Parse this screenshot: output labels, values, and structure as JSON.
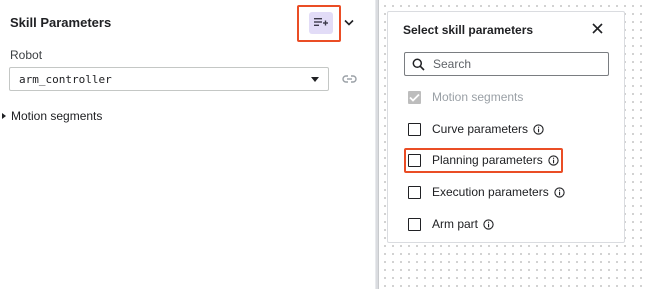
{
  "panel": {
    "title": "Skill Parameters",
    "robot_label": "Robot",
    "robot_value": "arm_controller",
    "motion_segments_label": "Motion segments"
  },
  "icons": {
    "add_parameter": "playlist-add-icon",
    "chevron": "chevron-down-icon",
    "link": "link-icon",
    "close": "close-icon",
    "search": "search-icon",
    "info": "info-icon",
    "expand": "triangle-right-icon"
  },
  "dialog": {
    "title": "Select skill parameters",
    "search_placeholder": "Search",
    "options": [
      {
        "label": "Motion segments",
        "checked": true,
        "disabled": true,
        "info": false
      },
      {
        "label": "Curve parameters",
        "checked": false,
        "disabled": false,
        "info": true
      },
      {
        "label": "Planning parameters",
        "checked": false,
        "disabled": false,
        "info": true,
        "highlighted": true
      },
      {
        "label": "Execution parameters",
        "checked": false,
        "disabled": false,
        "info": true
      },
      {
        "label": "Arm part",
        "checked": false,
        "disabled": false,
        "info": true
      }
    ]
  },
  "colors": {
    "highlight": "#ea4d25",
    "add_button_bg": "#e2dcf7",
    "disabled_check": "#bdbdbd"
  }
}
